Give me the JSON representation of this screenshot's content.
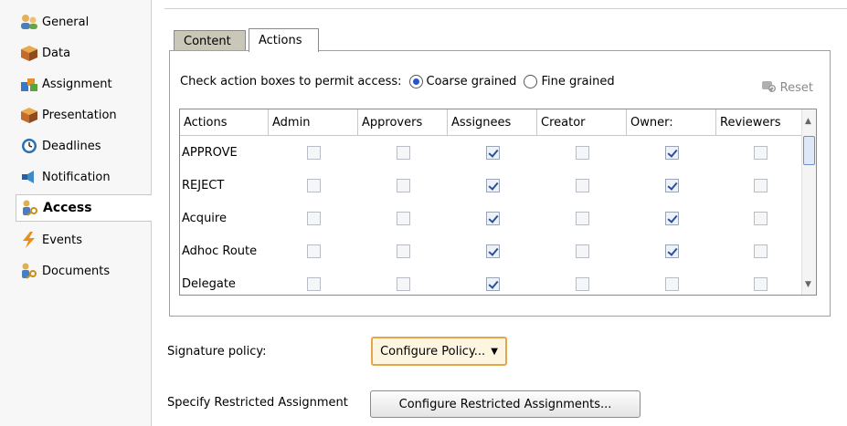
{
  "sidebar": {
    "items": [
      {
        "label": "General",
        "icon": "people-icon"
      },
      {
        "label": "Data",
        "icon": "cube-icon"
      },
      {
        "label": "Assignment",
        "icon": "assignment-icon"
      },
      {
        "label": "Presentation",
        "icon": "cube-icon"
      },
      {
        "label": "Deadlines",
        "icon": "clock-icon"
      },
      {
        "label": "Notification",
        "icon": "notification-icon"
      },
      {
        "label": "Access",
        "icon": "key-person-icon",
        "active": true
      },
      {
        "label": "Events",
        "icon": "lightning-icon"
      },
      {
        "label": "Documents",
        "icon": "key-person-icon"
      }
    ]
  },
  "tabs": [
    {
      "label": "Content",
      "active": false
    },
    {
      "label": "Actions",
      "active": true
    }
  ],
  "access": {
    "instruction": "Check action boxes to permit access:",
    "option_coarse": "Coarse grained",
    "option_fine": "Fine grained",
    "selected": "Coarse grained",
    "reset_label": "Reset"
  },
  "table": {
    "columns": [
      "Actions",
      "Admin",
      "Approvers",
      "Assignees",
      "Creator",
      "Owner:",
      "Reviewers"
    ],
    "rows": [
      {
        "name": "APPROVE",
        "checks": [
          false,
          false,
          true,
          false,
          true,
          false
        ]
      },
      {
        "name": "REJECT",
        "checks": [
          false,
          false,
          true,
          false,
          true,
          false
        ]
      },
      {
        "name": "Acquire",
        "checks": [
          false,
          false,
          true,
          false,
          true,
          false
        ]
      },
      {
        "name": "Adhoc Route",
        "checks": [
          false,
          false,
          true,
          false,
          true,
          false
        ]
      },
      {
        "name": "Delegate",
        "checks": [
          false,
          false,
          true,
          false,
          false,
          false
        ]
      }
    ]
  },
  "signature": {
    "label": "Signature policy:",
    "button_label": "Configure Policy..."
  },
  "restricted": {
    "label": "Specify Restricted Assignment",
    "button_label": "Configure Restricted Assignments..."
  },
  "colors": {
    "accent": "#2b4f9e",
    "policy_button_border": "#e3a64a",
    "inactive_tab": "#c9c8b8"
  }
}
